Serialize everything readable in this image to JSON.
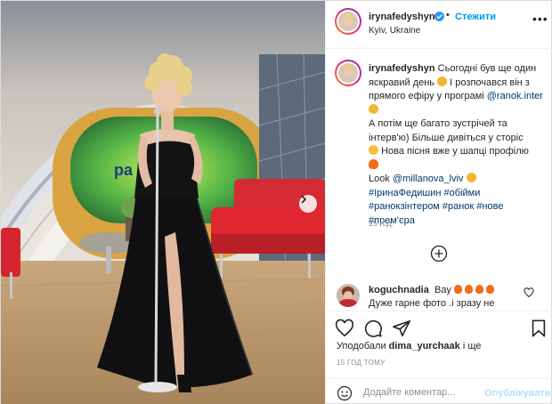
{
  "post": {
    "author": {
      "username": "irynafedyshyn",
      "verified": true,
      "follow_label": "Стежити",
      "location": "Kyiv, Ukraine"
    },
    "caption": {
      "username": "irynafedyshyn",
      "text_1": "Сьогодні був ще один яскравий день",
      "text_2": "І розпочався він з прямого ефіру у програмі",
      "mention_1": "@ranok.inter",
      "text_3": "А потім ще багато зустрічей та інтерв'ю) Більше дивіться у сторіс",
      "text_4": "Нова пісня вже у шапці профілю",
      "text_5": "Look",
      "mention_2": "@millanova_lviv",
      "hashtags_1": "#ІринаФедишин #обійми",
      "hashtags_2": "#ранокзінтером #ранок #нове",
      "hashtags_3": "#прем'єра",
      "time_ago": "15 год."
    },
    "comment": {
      "username": "koguchnadia",
      "text": "Вау",
      "text_2": "Дуже гарне фото .і зразу не"
    },
    "likes": {
      "prefix": "Уподобали",
      "user": "dima_yurchaak",
      "suffix": "і ще"
    },
    "date_label": "15 ГОД ТОМУ",
    "comment_input": {
      "placeholder": "Додайте коментар..."
    },
    "publish_label": "Опублікувати"
  },
  "photo": {
    "screen_text": "ра"
  },
  "icons": {
    "more": "more-options-icon",
    "verified": "verified-badge-icon",
    "next": "chevron-right-icon",
    "load_more": "plus-circle-icon",
    "like": "heart-icon",
    "comment": "comment-icon",
    "share": "share-icon",
    "save": "bookmark-icon",
    "emoji": "smiley-icon"
  },
  "colors": {
    "link": "#00376b",
    "follow": "#0095f6",
    "publish_disabled": "#b2dffc",
    "muted": "#8e8e8e",
    "sofa": "#e0262f"
  }
}
